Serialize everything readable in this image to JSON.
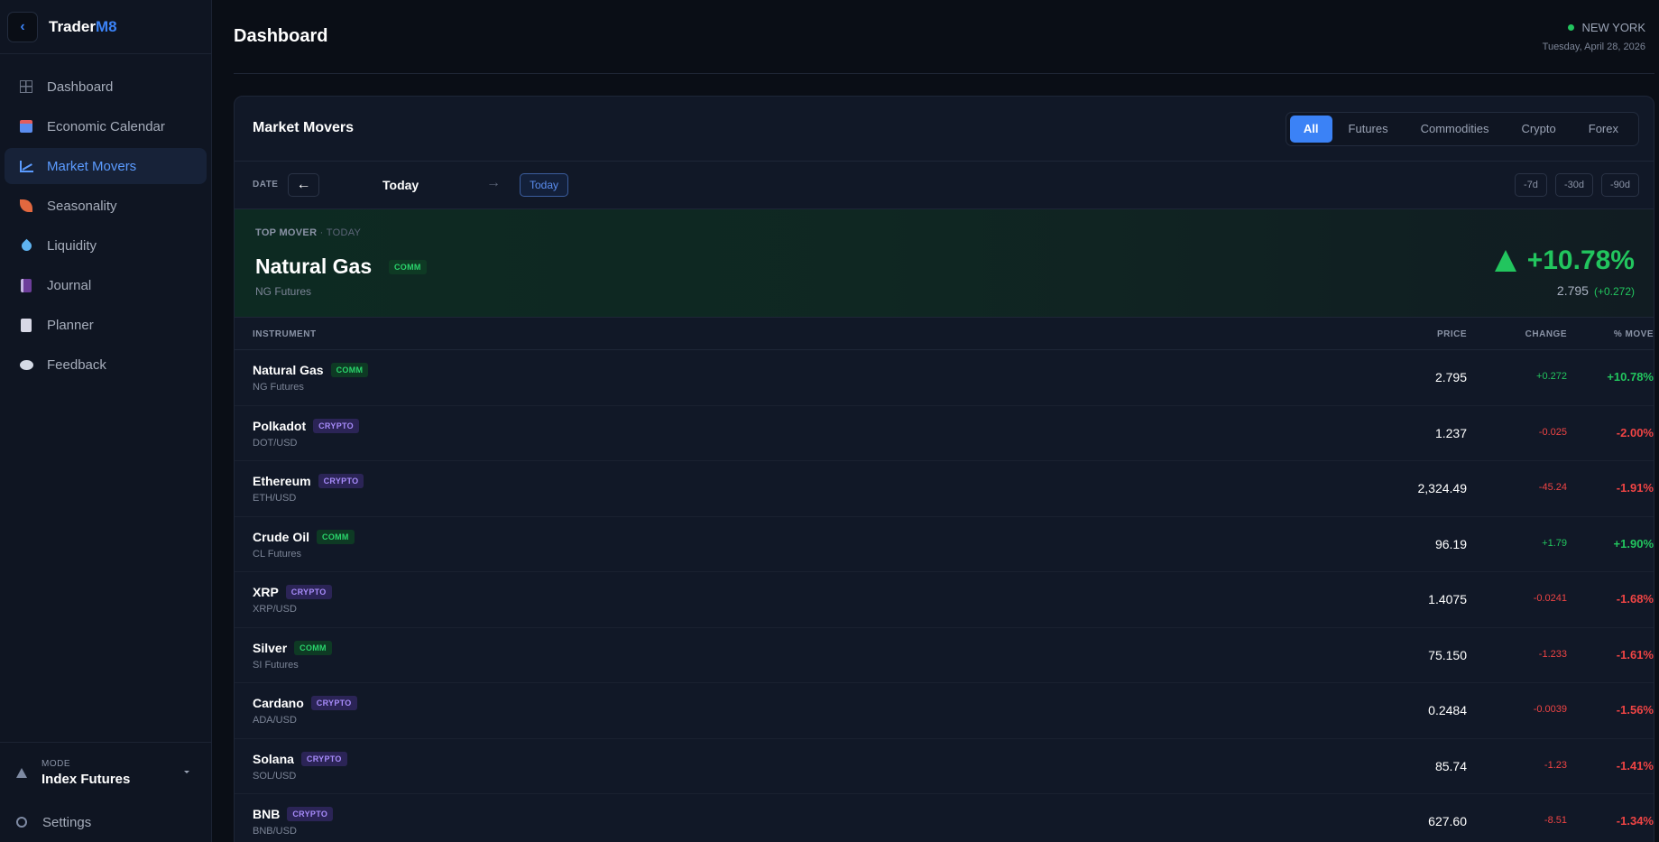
{
  "brand": {
    "name_main": "Trader",
    "name_accent": "M8",
    "back_glyph": "‹"
  },
  "sidebar": {
    "items": [
      {
        "label": "Dashboard",
        "icon": "grid-icon"
      },
      {
        "label": "Economic Calendar",
        "icon": "calendar-icon"
      },
      {
        "label": "Market Movers",
        "icon": "chart-icon",
        "active": true
      },
      {
        "label": "Seasonality",
        "icon": "leaf-icon"
      },
      {
        "label": "Liquidity",
        "icon": "droplet-icon"
      },
      {
        "label": "Journal",
        "icon": "journal-icon"
      },
      {
        "label": "Planner",
        "icon": "notepad-icon"
      },
      {
        "label": "Feedback",
        "icon": "speech-bubble-icon"
      }
    ],
    "mode_label": "MODE",
    "mode_value": "Index Futures",
    "settings_label": "Settings"
  },
  "header": {
    "title": "Dashboard",
    "city": "NEW YORK",
    "date": "Tuesday, April 28, 2026"
  },
  "panel": {
    "title": "Market Movers",
    "filters": [
      "All",
      "Futures",
      "Commodities",
      "Crypto",
      "Forex"
    ],
    "active_filter": "All",
    "date_label": "DATE",
    "prev_glyph": "←",
    "next_glyph": "→",
    "date_value": "Today",
    "today_button": "Today",
    "ranges": [
      "-7d",
      "-30d",
      "-90d"
    ]
  },
  "top_mover": {
    "label": "TOP MOVER",
    "label_sub": "· TODAY",
    "name": "Natural Gas",
    "badge": "COMM",
    "sub": "NG Futures",
    "pct": "+10.78%",
    "price": "2.795",
    "change": "(+0.272)"
  },
  "table": {
    "headers": {
      "instrument": "INSTRUMENT",
      "price": "PRICE",
      "change": "CHANGE",
      "move": "% MOVE"
    },
    "rows": [
      {
        "name": "Natural Gas",
        "badge": "COMM",
        "sub": "NG Futures",
        "price": "2.795",
        "change": "+0.272",
        "move": "+10.78%",
        "dir": "pos"
      },
      {
        "name": "Polkadot",
        "badge": "CRYPTO",
        "sub": "DOT/USD",
        "price": "1.237",
        "change": "-0.025",
        "move": "-2.00%",
        "dir": "neg"
      },
      {
        "name": "Ethereum",
        "badge": "CRYPTO",
        "sub": "ETH/USD",
        "price": "2,324.49",
        "change": "-45.24",
        "move": "-1.91%",
        "dir": "neg"
      },
      {
        "name": "Crude Oil",
        "badge": "COMM",
        "sub": "CL Futures",
        "price": "96.19",
        "change": "+1.79",
        "move": "+1.90%",
        "dir": "pos"
      },
      {
        "name": "XRP",
        "badge": "CRYPTO",
        "sub": "XRP/USD",
        "price": "1.4075",
        "change": "-0.0241",
        "move": "-1.68%",
        "dir": "neg"
      },
      {
        "name": "Silver",
        "badge": "COMM",
        "sub": "SI Futures",
        "price": "75.150",
        "change": "-1.233",
        "move": "-1.61%",
        "dir": "neg"
      },
      {
        "name": "Cardano",
        "badge": "CRYPTO",
        "sub": "ADA/USD",
        "price": "0.2484",
        "change": "-0.0039",
        "move": "-1.56%",
        "dir": "neg"
      },
      {
        "name": "Solana",
        "badge": "CRYPTO",
        "sub": "SOL/USD",
        "price": "85.74",
        "change": "-1.23",
        "move": "-1.41%",
        "dir": "neg"
      },
      {
        "name": "BNB",
        "badge": "CRYPTO",
        "sub": "BNB/USD",
        "price": "627.60",
        "change": "-8.51",
        "move": "-1.34%",
        "dir": "neg"
      }
    ]
  },
  "colors": {
    "accent": "#3b82f6",
    "positive": "#22c55e",
    "negative": "#ef4444",
    "comm": "#2ad46b",
    "crypto": "#a78bfa"
  }
}
